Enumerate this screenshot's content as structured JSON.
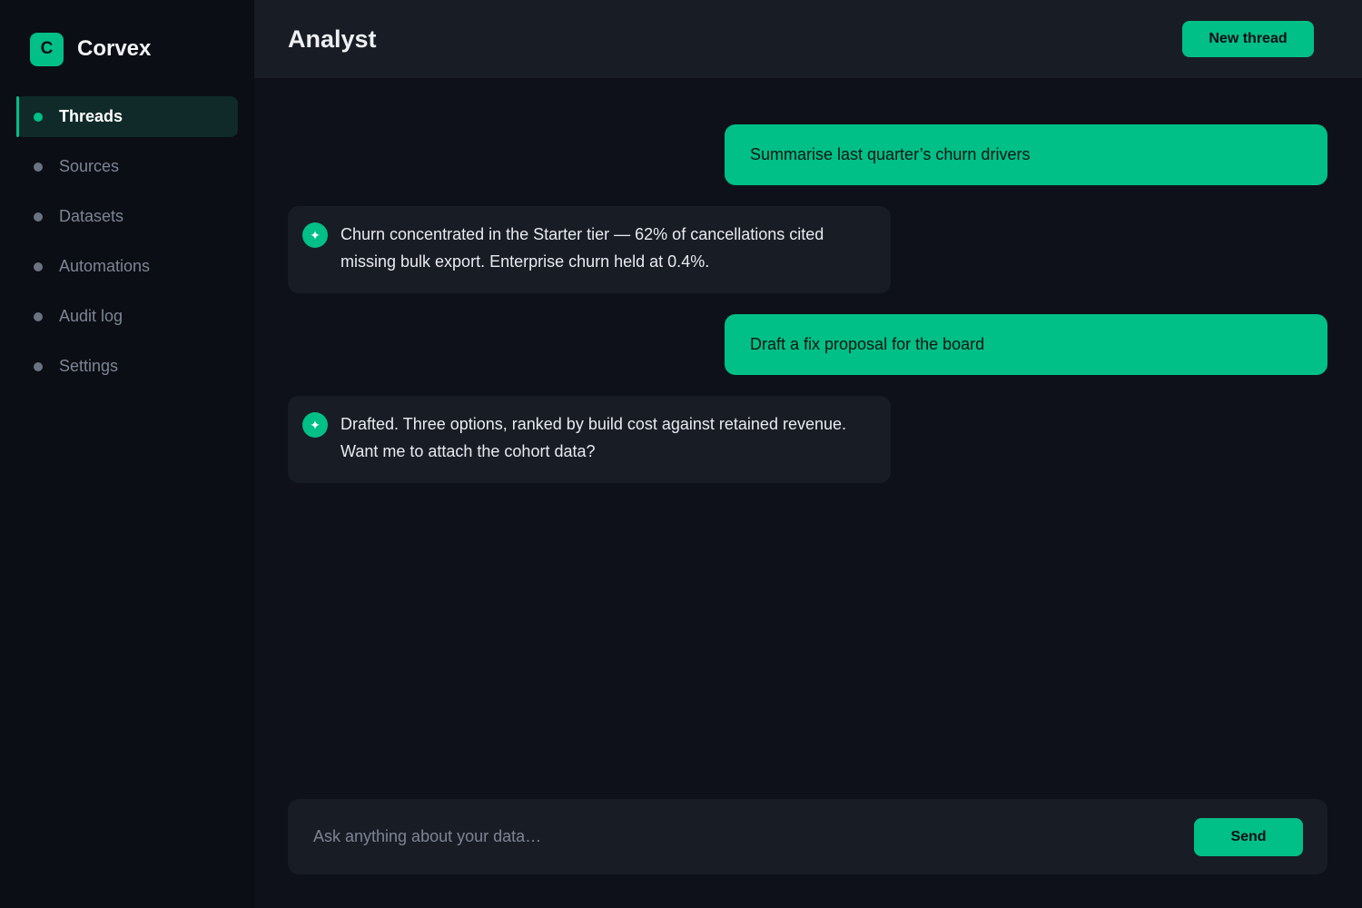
{
  "brand": {
    "logo_letter": "C",
    "name": "Corvex"
  },
  "sidebar": {
    "items": [
      {
        "label": "Threads",
        "active": true
      },
      {
        "label": "Sources",
        "active": false
      },
      {
        "label": "Datasets",
        "active": false
      },
      {
        "label": "Automations",
        "active": false
      },
      {
        "label": "Audit log",
        "active": false
      },
      {
        "label": "Settings",
        "active": false
      }
    ]
  },
  "header": {
    "title": "Analyst",
    "new_thread_label": "New thread"
  },
  "messages": [
    {
      "role": "user",
      "text": "Summarise last quarter’s churn drivers"
    },
    {
      "role": "assistant",
      "icon": "sparkle-icon",
      "text": "Churn concentrated in the Starter tier — 62% of cancellations cited missing bulk export. Enterprise churn held at 0.4%."
    },
    {
      "role": "user",
      "text": "Draft a fix proposal for the board"
    },
    {
      "role": "assistant",
      "icon": "sparkle-icon",
      "text": "Drafted. Three options, ranked by build cost against retained revenue. Want me to attach the cohort data?"
    }
  ],
  "composer": {
    "placeholder": "Ask anything about your data…",
    "value": "",
    "send_label": "Send"
  },
  "colors": {
    "accent": "#00bf87",
    "background": "#0e1119",
    "sidebar": "#0b0e15",
    "panel": "#181c25"
  }
}
